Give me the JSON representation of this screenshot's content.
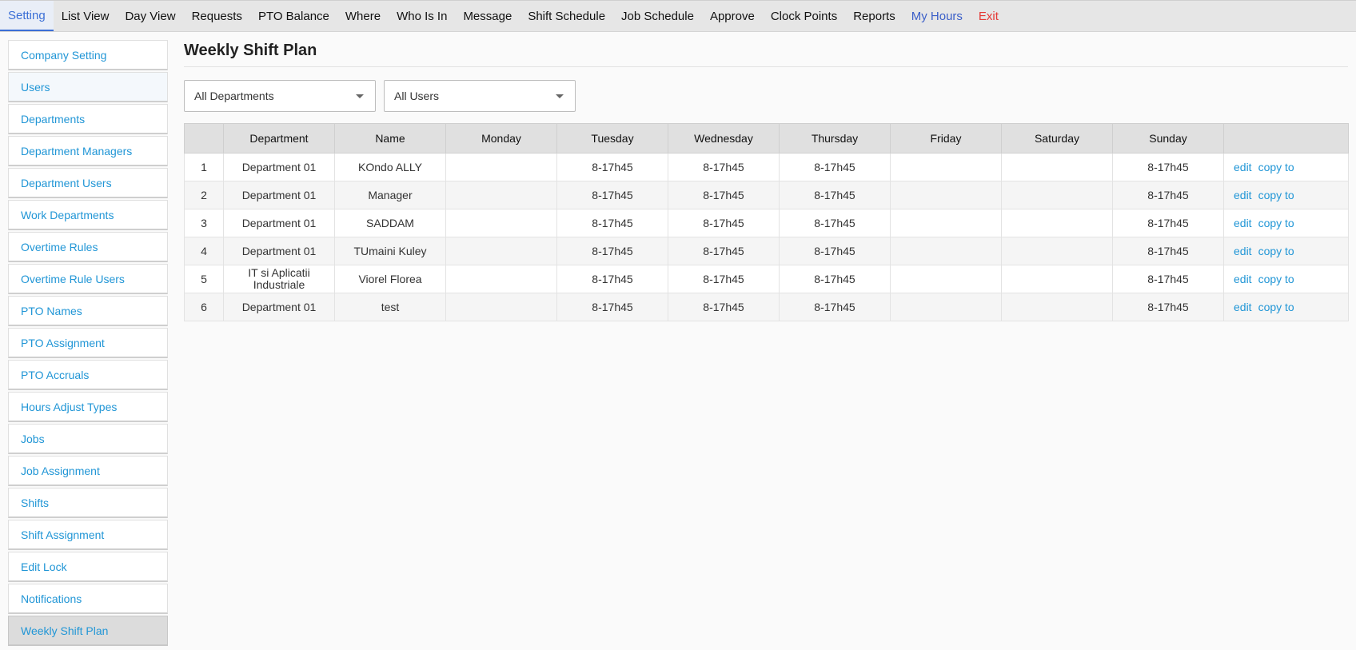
{
  "topnav": [
    {
      "label": "Setting",
      "name": "nav-setting",
      "cls": "active"
    },
    {
      "label": "List View",
      "name": "nav-list-view",
      "cls": ""
    },
    {
      "label": "Day View",
      "name": "nav-day-view",
      "cls": ""
    },
    {
      "label": "Requests",
      "name": "nav-requests",
      "cls": ""
    },
    {
      "label": "PTO Balance",
      "name": "nav-pto-balance",
      "cls": ""
    },
    {
      "label": "Where",
      "name": "nav-where",
      "cls": ""
    },
    {
      "label": "Who Is In",
      "name": "nav-who-is-in",
      "cls": ""
    },
    {
      "label": "Message",
      "name": "nav-message",
      "cls": ""
    },
    {
      "label": "Shift Schedule",
      "name": "nav-shift-schedule",
      "cls": ""
    },
    {
      "label": "Job Schedule",
      "name": "nav-job-schedule",
      "cls": ""
    },
    {
      "label": "Approve",
      "name": "nav-approve",
      "cls": ""
    },
    {
      "label": "Clock Points",
      "name": "nav-clock-points",
      "cls": ""
    },
    {
      "label": "Reports",
      "name": "nav-reports",
      "cls": ""
    },
    {
      "label": "My Hours",
      "name": "nav-my-hours",
      "cls": "myhours"
    },
    {
      "label": "Exit",
      "name": "nav-exit",
      "cls": "exit"
    }
  ],
  "sidebar": [
    {
      "label": "Company Setting",
      "state": ""
    },
    {
      "label": "Users",
      "state": "hover"
    },
    {
      "label": "Departments",
      "state": ""
    },
    {
      "label": "Department Managers",
      "state": ""
    },
    {
      "label": "Department Users",
      "state": ""
    },
    {
      "label": "Work Departments",
      "state": ""
    },
    {
      "label": "Overtime Rules",
      "state": ""
    },
    {
      "label": "Overtime Rule Users",
      "state": ""
    },
    {
      "label": "PTO Names",
      "state": ""
    },
    {
      "label": "PTO Assignment",
      "state": ""
    },
    {
      "label": "PTO Accruals",
      "state": ""
    },
    {
      "label": "Hours Adjust Types",
      "state": ""
    },
    {
      "label": "Jobs",
      "state": ""
    },
    {
      "label": "Job Assignment",
      "state": ""
    },
    {
      "label": "Shifts",
      "state": ""
    },
    {
      "label": "Shift Assignment",
      "state": ""
    },
    {
      "label": "Edit Lock",
      "state": ""
    },
    {
      "label": "Notifications",
      "state": ""
    },
    {
      "label": "Weekly Shift Plan",
      "state": "active"
    }
  ],
  "main": {
    "title": "Weekly Shift Plan",
    "filters": {
      "department": "All Departments",
      "user": "All Users"
    },
    "columns": [
      "",
      "Department",
      "Name",
      "Monday",
      "Tuesday",
      "Wednesday",
      "Thursday",
      "Friday",
      "Saturday",
      "Sunday",
      ""
    ],
    "rows": [
      {
        "num": "1",
        "department": "Department 01",
        "name": "KOndo ALLY",
        "days": [
          "",
          "8-17h45",
          "8-17h45",
          "8-17h45",
          "",
          "",
          "8-17h45"
        ]
      },
      {
        "num": "2",
        "department": "Department 01",
        "name": "Manager",
        "days": [
          "",
          "8-17h45",
          "8-17h45",
          "8-17h45",
          "",
          "",
          "8-17h45"
        ]
      },
      {
        "num": "3",
        "department": "Department 01",
        "name": "SADDAM",
        "days": [
          "",
          "8-17h45",
          "8-17h45",
          "8-17h45",
          "",
          "",
          "8-17h45"
        ]
      },
      {
        "num": "4",
        "department": "Department 01",
        "name": "TUmaini Kuley",
        "days": [
          "",
          "8-17h45",
          "8-17h45",
          "8-17h45",
          "",
          "",
          "8-17h45"
        ]
      },
      {
        "num": "5",
        "department": "IT si Aplicatii Industriale",
        "name": "Viorel Florea",
        "days": [
          "",
          "8-17h45",
          "8-17h45",
          "8-17h45",
          "",
          "",
          "8-17h45"
        ]
      },
      {
        "num": "6",
        "department": "Department 01",
        "name": "test",
        "days": [
          "",
          "8-17h45",
          "8-17h45",
          "8-17h45",
          "",
          "",
          "8-17h45"
        ]
      }
    ],
    "actions": {
      "edit": "edit",
      "copy": "copy to"
    }
  },
  "colors": {
    "accent": "#2196d6",
    "active_tab": "#3b6fd6",
    "exit": "#e53935"
  }
}
